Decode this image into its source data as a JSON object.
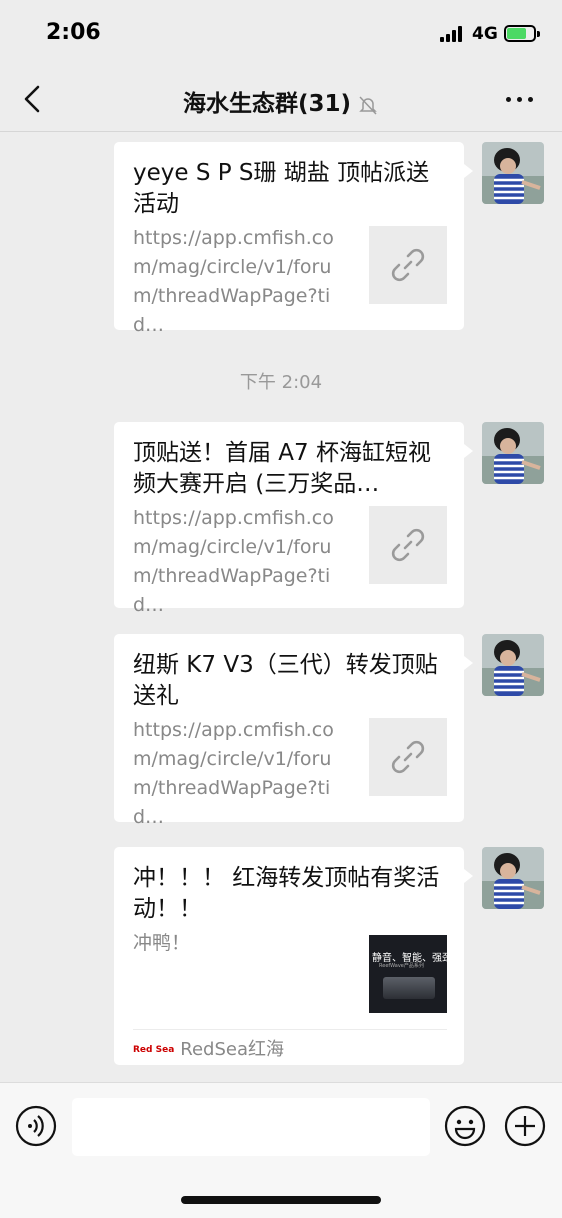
{
  "status_bar": {
    "time": "2:06",
    "network": "4G",
    "battery_level": 0.65
  },
  "header": {
    "title": "海水生态群(31)",
    "muted_icon": "bell-slash-icon"
  },
  "timestamp": "下午 2:04",
  "messages": [
    {
      "title": "yeye S P S珊 瑚盐 顶帖派送活动",
      "desc": "https://app.cmfish.com/mag/circle/v1/forum/threadWapPage?tid…",
      "thumb_icon": "link-icon"
    },
    {
      "title": "顶贴送！首届 A7 杯海缸短视频大赛开启 (三万奖品…",
      "desc": "https://app.cmfish.com/mag/circle/v1/forum/threadWapPage?tid…",
      "thumb_icon": "link-icon"
    },
    {
      "title": "纽斯 K7 V3（三代）转发顶贴送礼",
      "desc": "https://app.cmfish.com/mag/circle/v1/forum/threadWapPage?tid…",
      "thumb_icon": "link-icon"
    },
    {
      "title": "冲！！！ 红海转发顶帖有奖活动！！",
      "desc": "冲鸭！",
      "thumb_text": "静音、智能、强劲",
      "thumb_sub": "ReefWave产品系列",
      "source_logo": "Red Sea",
      "source": "RedSea红海"
    }
  ],
  "input": {
    "value": "",
    "placeholder": ""
  },
  "icons": {
    "back": "chevron-left-icon",
    "more": "more-icon",
    "voice": "voice-icon",
    "emoji": "emoji-icon",
    "plus": "plus-icon"
  },
  "colors": {
    "background": "#ededed",
    "bubble": "#ffffff",
    "battery": "#4cd964"
  }
}
